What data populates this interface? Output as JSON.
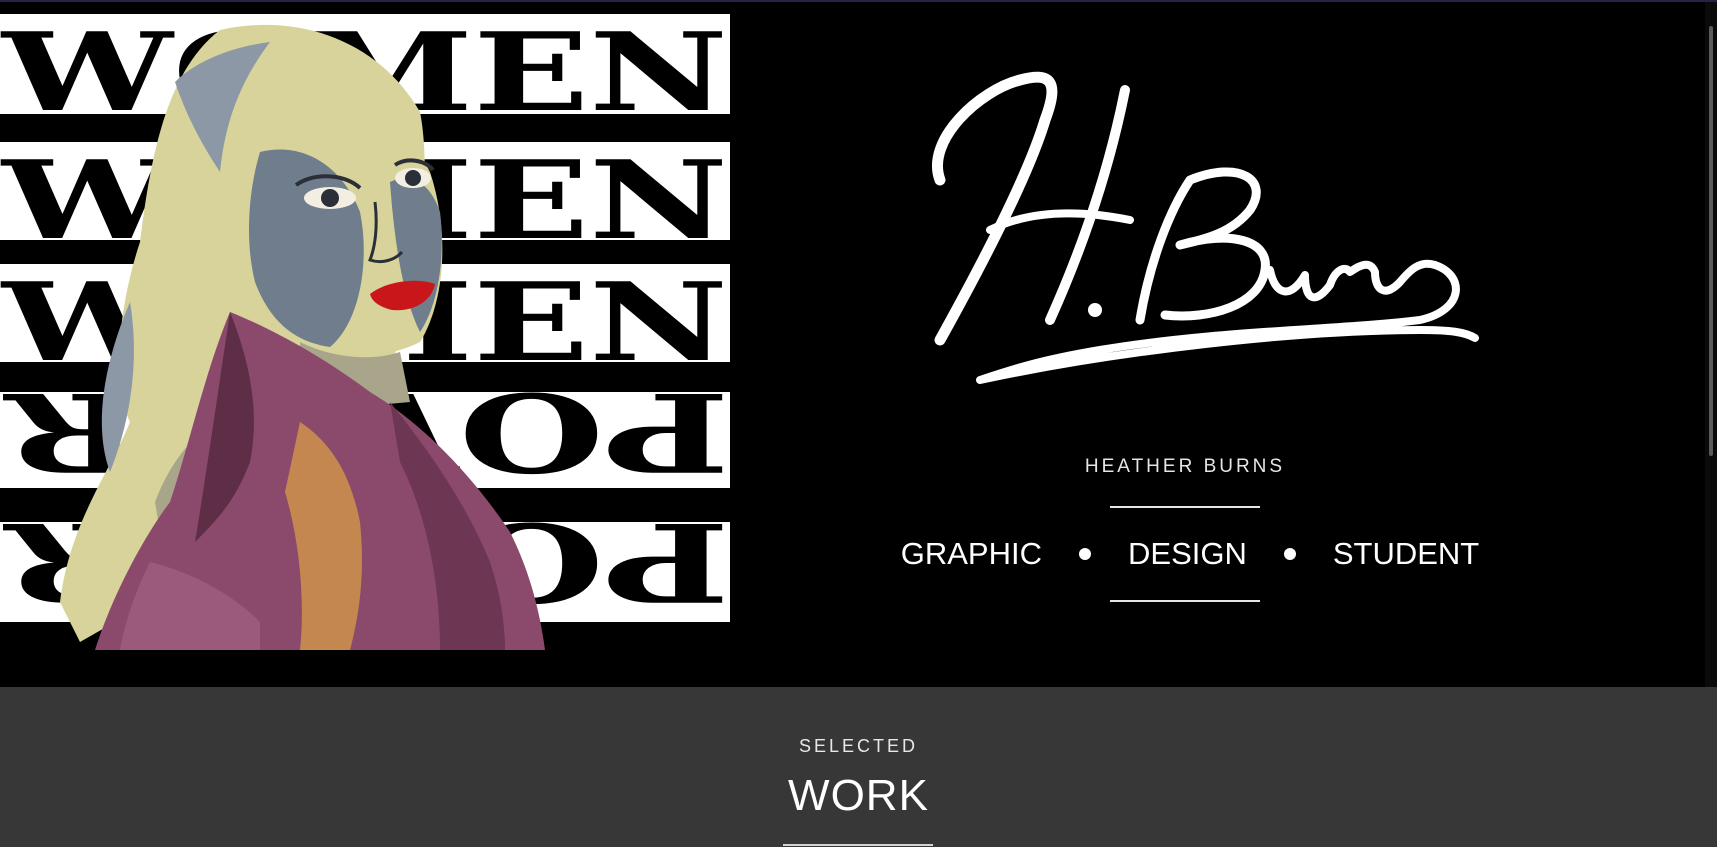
{
  "hero": {
    "poster": {
      "repeated_text_top": "WOMEN",
      "repeated_text_bottom": "POWER"
    },
    "signature_text": "H. Burns",
    "name": "HEATHER BURNS",
    "tagline": [
      "GRAPHIC",
      "DESIGN",
      "STUDENT"
    ]
  },
  "work_section": {
    "kicker": "SELECTED",
    "title": "WORK"
  },
  "colors": {
    "hero_background": "#000000",
    "work_background": "#373737",
    "text": "#ffffff",
    "jacket": "#8b4a6b",
    "lips": "#c8161b",
    "hair": "#d8d39a",
    "skin_shadow": "#6f7d8c"
  }
}
